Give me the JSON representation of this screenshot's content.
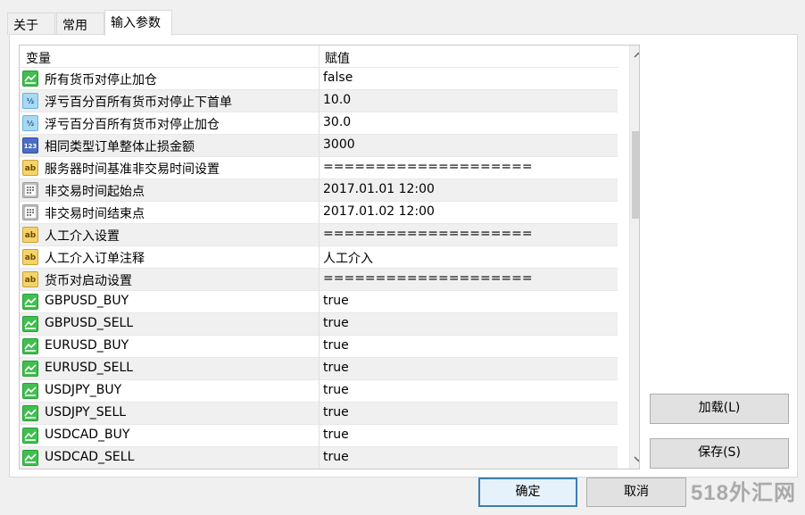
{
  "tabs": [
    "关于",
    "常用",
    "输入参数"
  ],
  "grid": {
    "header_variable": "变量",
    "header_value": "赋值",
    "rows": [
      {
        "type": "bool",
        "name": "所有货币对停止加仓",
        "value": "false"
      },
      {
        "type": "double",
        "name": "浮亏百分百所有货币对停止下首单",
        "value": "10.0"
      },
      {
        "type": "double",
        "name": "浮亏百分百所有货币对停止加仓",
        "value": "30.0"
      },
      {
        "type": "int",
        "name": "相同类型订单整体止损金额",
        "value": "3000"
      },
      {
        "type": "string",
        "name": "服务器时间基准非交易时间设置",
        "value": "===================="
      },
      {
        "type": "datetime",
        "name": "非交易时间起始点",
        "value": "2017.01.01 12:00"
      },
      {
        "type": "datetime",
        "name": "非交易时间结束点",
        "value": "2017.01.02 12:00"
      },
      {
        "type": "string",
        "name": "人工介入设置",
        "value": "===================="
      },
      {
        "type": "string",
        "name": "人工介入订单注释",
        "value": "人工介入"
      },
      {
        "type": "string",
        "name": "货币对启动设置",
        "value": "===================="
      },
      {
        "type": "bool",
        "name": "GBPUSD_BUY",
        "value": "true"
      },
      {
        "type": "bool",
        "name": "GBPUSD_SELL",
        "value": "true"
      },
      {
        "type": "bool",
        "name": "EURUSD_BUY",
        "value": "true"
      },
      {
        "type": "bool",
        "name": "EURUSD_SELL",
        "value": "true"
      },
      {
        "type": "bool",
        "name": "USDJPY_BUY",
        "value": "true"
      },
      {
        "type": "bool",
        "name": "USDJPY_SELL",
        "value": "true"
      },
      {
        "type": "bool",
        "name": "USDCAD_BUY",
        "value": "true"
      },
      {
        "type": "bool",
        "name": "USDCAD_SELL",
        "value": "true"
      }
    ]
  },
  "icons": {
    "bool": "bool-type-icon",
    "double": "double-type-icon",
    "int": "int-type-icon",
    "string": "string-type-icon",
    "datetime": "datetime-type-icon"
  },
  "icon_text": {
    "double": "½",
    "int": "123",
    "string": "ab"
  },
  "buttons": {
    "load": "加载(L)",
    "save": "保存(S)",
    "ok": "确定",
    "cancel": "取消"
  },
  "watermark": "518外汇网",
  "colors": {
    "default_button_border": "#3c7fb1",
    "alt_row": "#f0f0f0"
  }
}
